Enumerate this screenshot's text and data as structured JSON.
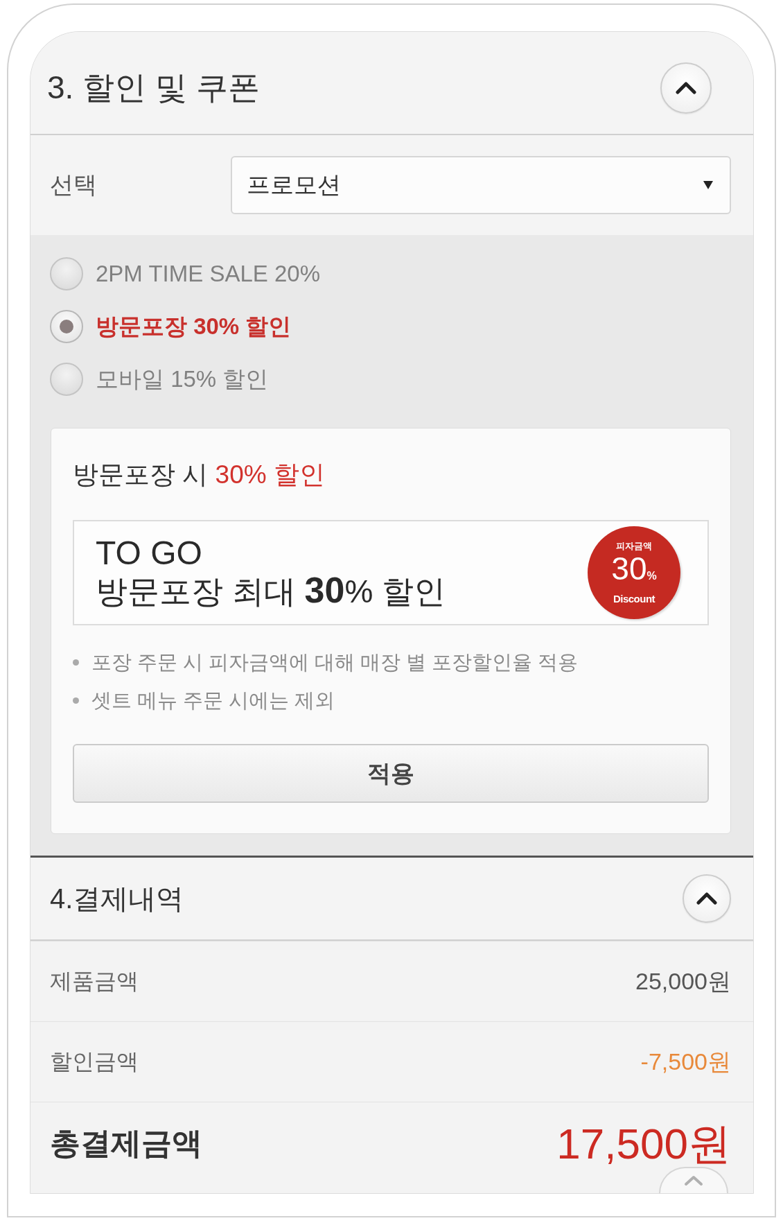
{
  "discount_section": {
    "title": "3. 할인 및 쿠폰",
    "expanded": true,
    "select": {
      "label": "선택",
      "value": "프로모션"
    },
    "options": [
      {
        "label": "2PM TIME SALE 20%",
        "selected": false
      },
      {
        "label": "방문포장 30% 할인",
        "selected": true
      },
      {
        "label": "모바일 15% 할인",
        "selected": false
      }
    ],
    "promo_card": {
      "title": "방문포장 시",
      "highlight": "30% 할인",
      "banner": {
        "line_1": "TO GO",
        "line_2": "방문포장 최대 **30**% 할인",
        "badge": {
          "caption": "피자금액",
          "value": "30",
          "unit": "%",
          "subcaption": "Discount"
        }
      },
      "notes": [
        "포장 주문 시 피자금액에 대해 매장 별 포장할인율 적용",
        "셋트 메뉴 주문 시에는 제외"
      ],
      "button": "적용"
    }
  },
  "payment_section": {
    "title": "4.결제내역",
    "expanded": true,
    "rows": [
      {
        "kind": "subtotal",
        "label": "제품금액",
        "value": "25,000원"
      },
      {
        "kind": "discount",
        "label": "할인금액",
        "value": "-7,500원"
      },
      {
        "kind": "total",
        "label": "총결제금액",
        "value": "17,500원"
      }
    ]
  }
}
